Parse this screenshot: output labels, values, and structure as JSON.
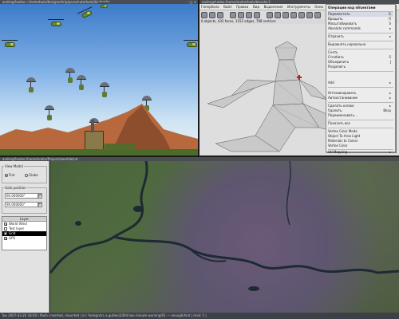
{
  "game": {
    "title": "andre@fradeo:~/hometools/bin/gravitrip/parachute/tools/bin/battle",
    "controls": "- □ ×"
  },
  "modeller": {
    "title": "andre@fradeo:/home/andre/tools/blender3",
    "window_label": "Гипербола",
    "menu": [
      "Вайл",
      "Правка",
      "Вид",
      "Выделение",
      "Инструменты",
      "Окно",
      "Справка"
    ],
    "stats": "0 objects, 432 faces, 1152 edges, 768 vertices",
    "context_menu": {
      "title": "Операции над объектами",
      "items": [
        {
          "label": "Переместить",
          "shortcut": "G"
        },
        {
          "label": "Вращать",
          "shortcut": "R"
        },
        {
          "label": "Масштабировать",
          "shortcut": "S"
        },
        {
          "label": "Absolute commands",
          "shortcut": "▸"
        },
        {
          "label": "Отразить",
          "shortcut": "▸"
        },
        {
          "label": "Выровнять нормально",
          "shortcut": ""
        },
        {
          "label": "Снять",
          "shortcut": ""
        },
        {
          "label": "Столбить",
          "shortcut": "S"
        },
        {
          "label": "Объединить",
          "shortcut": "J"
        },
        {
          "label": "Разделить",
          "shortcut": ""
        },
        {
          "label": "Add",
          "shortcut": "▸"
        },
        {
          "label": "Оптимизировать",
          "shortcut": "▸"
        },
        {
          "label": "Автоостанивание",
          "shortcut": "▸"
        },
        {
          "label": "Сделать копию",
          "shortcut": "▸"
        },
        {
          "label": "Удалить",
          "shortcut": "Bksp"
        },
        {
          "label": "Переименовать...",
          "shortcut": ""
        },
        {
          "label": "Показать все",
          "shortcut": ""
        },
        {
          "label": "Vertex Color Mode",
          "shortcut": ""
        },
        {
          "label": "Object To Area Light",
          "shortcut": ""
        },
        {
          "label": "Materials to Colors",
          "shortcut": ""
        },
        {
          "label": "Vertex Color",
          "shortcut": ""
        },
        {
          "label": "UV Mapping",
          "shortcut": "▸"
        }
      ]
    }
  },
  "map": {
    "title": "andre@fradeo:/home/andre/Projects/worldwind",
    "view_model_label": "View Model",
    "flat_label": "Flat",
    "globe_label": "Globe",
    "goto_label": "Goto position",
    "lat_value": "60.000000°",
    "lon_value": "90.000000°",
    "layer_header": "Layer",
    "layers": [
      {
        "name": "World Wind",
        "checked": true,
        "selected": false
      },
      {
        "name": "Test layer",
        "checked": false,
        "selected": false
      },
      {
        "name": "Grid",
        "checked": true,
        "selected": true
      },
      {
        "name": "GPS",
        "checked": true,
        "selected": false
      }
    ]
  },
  "taskbar": {
    "text": "Tue 2007-03-20 18:00 | flash: inserted, mounted | irc: foreign/irc.e.gutlen/2004 two minute warning/01 — enough/hint | mail: 5 |"
  }
}
